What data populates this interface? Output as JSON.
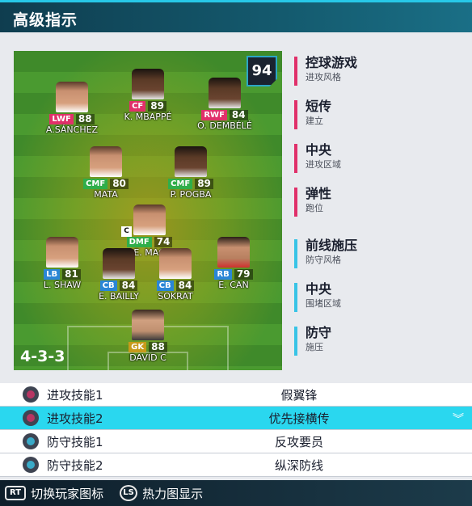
{
  "header": {
    "title": "高级指示"
  },
  "team": {
    "overall": "94",
    "formation": "4-3-3"
  },
  "players": [
    {
      "pos": "LWF",
      "rating": "88",
      "name": "A.SÁNCHEZ"
    },
    {
      "pos": "CF",
      "rating": "89",
      "name": "K. MBAPPÉ"
    },
    {
      "pos": "RWF",
      "rating": "84",
      "name": "O. DEMBÉLÉ"
    },
    {
      "pos": "CMF",
      "rating": "80",
      "name": "MATA"
    },
    {
      "pos": "CMF",
      "rating": "89",
      "name": "P. POGBA"
    },
    {
      "pos": "DMF",
      "rating": "74",
      "name": "E. MAG",
      "captain": "C"
    },
    {
      "pos": "LB",
      "rating": "81",
      "name": "L. SHAW"
    },
    {
      "pos": "CB",
      "rating": "84",
      "name": "E. BAILLY"
    },
    {
      "pos": "CB",
      "rating": "84",
      "name": "SOKRAT"
    },
    {
      "pos": "RB",
      "rating": "79",
      "name": "E. CAN"
    },
    {
      "pos": "GK",
      "rating": "88",
      "name": "DAVID C"
    }
  ],
  "tactics": [
    {
      "title": "控球游戏",
      "sub": "进攻风格",
      "kind": "attack"
    },
    {
      "title": "短传",
      "sub": "建立",
      "kind": "attack"
    },
    {
      "title": "中央",
      "sub": "进攻区域",
      "kind": "attack"
    },
    {
      "title": "弹性",
      "sub": "跑位",
      "kind": "attack"
    },
    {
      "title": "前线施压",
      "sub": "防守风格",
      "kind": "defense"
    },
    {
      "title": "中央",
      "sub": "围堵区域",
      "kind": "defense"
    },
    {
      "title": "防守",
      "sub": "施压",
      "kind": "defense"
    }
  ],
  "skills": [
    {
      "label": "进攻技能1",
      "value": "假翼锋",
      "kind": "attack",
      "selected": false
    },
    {
      "label": "进攻技能2",
      "value": "优先接横传",
      "kind": "attack",
      "selected": true
    },
    {
      "label": "防守技能1",
      "value": "反攻要员",
      "kind": "defense",
      "selected": false
    },
    {
      "label": "防守技能2",
      "value": "纵深防线",
      "kind": "defense",
      "selected": false
    }
  ],
  "footer": {
    "rt_key": "RT",
    "rt_label": "切换玩家图标",
    "ls_key": "LS",
    "ls_label": "热力图显示"
  },
  "colors": {
    "accent": "#2ad7ef",
    "attack": "#e0306a",
    "defense": "#38c4e6",
    "midfield": "#2fae4a",
    "defender": "#2a86d6",
    "goalkeeper": "#c79a1a"
  }
}
